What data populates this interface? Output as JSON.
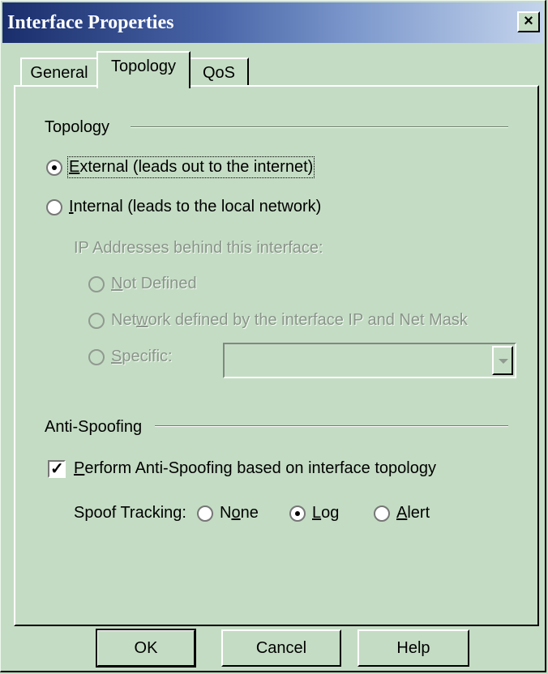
{
  "window": {
    "title": "Interface Properties",
    "close_label": "×"
  },
  "tabs": [
    {
      "label": "General",
      "active": false
    },
    {
      "label": "Topology",
      "active": true
    },
    {
      "label": "QoS",
      "active": false
    }
  ],
  "topology": {
    "group_label": "Topology",
    "external": {
      "accel": "E",
      "rest": "xternal (leads out to the internet)",
      "checked": true
    },
    "internal": {
      "accel": "I",
      "rest": "nternal (leads to the local network)",
      "checked": false
    },
    "ip_label": "IP Addresses behind this interface:",
    "not_defined": {
      "accel": "N",
      "rest": "ot Defined"
    },
    "network_defined": {
      "pre": "Net",
      "accel": "w",
      "rest": "ork defined by the interface IP and Net Mask"
    },
    "specific": {
      "accel": "S",
      "rest": "pecific:"
    },
    "specific_value": ""
  },
  "antispoofing": {
    "group_label": "Anti-Spoofing",
    "perform": {
      "accel": "P",
      "rest": "erform Anti-Spoofing based on interface topology",
      "checked": true
    },
    "tracking_label": "Spoof Tracking:",
    "none": {
      "pre": "N",
      "accel": "o",
      "rest": "ne",
      "checked": false
    },
    "log": {
      "accel": "L",
      "rest": "og",
      "checked": true
    },
    "alert": {
      "accel": "A",
      "rest": "lert",
      "checked": false
    }
  },
  "buttons": {
    "ok": "OK",
    "cancel": "Cancel",
    "help": "Help"
  }
}
